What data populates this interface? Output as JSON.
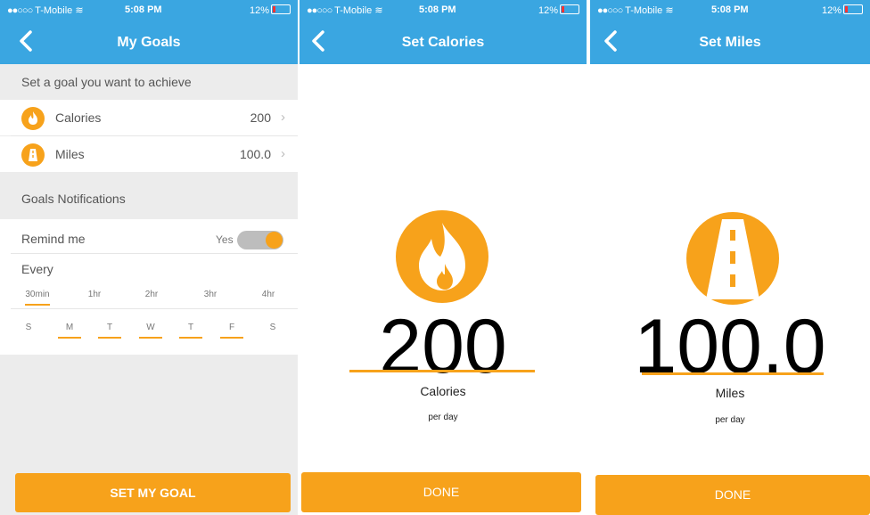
{
  "status": {
    "carrier": "T-Mobile",
    "time": "5:08 PM",
    "battery": "12%"
  },
  "goals_screen": {
    "title": "My Goals",
    "section_title": "Set a goal you want to achieve",
    "rows": [
      {
        "label": "Calories",
        "value": "200",
        "icon": "flame-icon"
      },
      {
        "label": "Miles",
        "value": "100.0",
        "icon": "road-icon"
      }
    ],
    "notifications_title": "Goals Notifications",
    "remind_label": "Remind me",
    "remind_value": "Yes",
    "remind_on": true,
    "every_label": "Every",
    "intervals": [
      "30min",
      "1hr",
      "2hr",
      "3hr",
      "4hr"
    ],
    "selected_interval": "30min",
    "days": [
      "S",
      "M",
      "T",
      "W",
      "T",
      "F",
      "S"
    ],
    "selected_days": [
      1,
      2,
      3,
      4,
      5
    ],
    "button": "SET MY GOAL"
  },
  "calories_screen": {
    "title": "Set Calories",
    "value": "200",
    "unit": "Calories",
    "per": "per day",
    "button": "DONE",
    "icon": "flame-icon"
  },
  "miles_screen": {
    "title": "Set Miles",
    "value": "100.0",
    "unit": "Miles",
    "per": "per day",
    "button": "DONE",
    "icon": "road-icon"
  },
  "colors": {
    "header": "#3aa6e1",
    "accent": "#f7a21b",
    "background": "#ececec"
  }
}
